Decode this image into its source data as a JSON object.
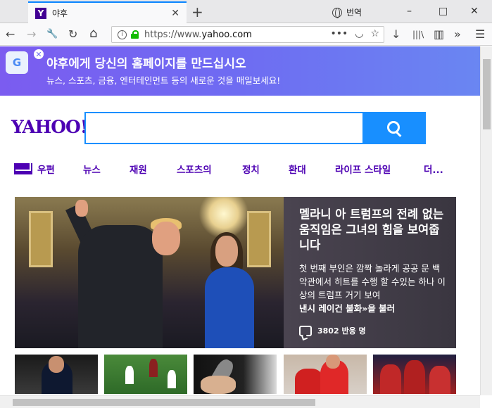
{
  "browser": {
    "tab": {
      "favicon": "Y",
      "title": "야후",
      "close_icon": "close-icon"
    },
    "new_tab_icon": "plus-icon",
    "translate": {
      "label": "번역",
      "icon": "globe-icon"
    },
    "window_controls": {
      "minimize": "–",
      "maximize": "□",
      "close": "✕"
    },
    "toolbar": {
      "back": "←",
      "forward": "→",
      "tools": "🔧",
      "reload": "↻",
      "home": "⌂",
      "url_prefix": "https://www.",
      "url_domain": "yahoo.com",
      "page_actions": "•••",
      "pocket": "◡",
      "bookmark": "☆",
      "download": "↓",
      "library": "|||\\",
      "sidebar": "▥",
      "overflow": "»",
      "menu": "☰"
    }
  },
  "banner": {
    "logo": "G",
    "title": "야후에게 당신의 홈페이지를 만드십시오",
    "subtitle": "뉴스, 스포츠, 금융, 엔터테인먼트 등의 새로운 것을 매일보세요!"
  },
  "header": {
    "logo": "YAHOO!",
    "search_placeholder": ""
  },
  "nav": {
    "items": [
      {
        "label": "우편"
      },
      {
        "label": "뉴스"
      },
      {
        "label": "재원"
      },
      {
        "label": "스포츠의"
      },
      {
        "label": "정치"
      },
      {
        "label": "환대"
      },
      {
        "label": "라이프 스타일"
      },
      {
        "label": "더..."
      }
    ]
  },
  "hero": {
    "title": "멜라니 아 트럼프의 전례 없는 움직임은 그녀의 힘을 보여줍니다",
    "desc": "첫 번째 부인은 깜짝 놀라게 공공 문 백악관에서 히트를 수행 할 수있는 하나 이상의 트럼프 거기 보여",
    "desc_bold": "낸시 레이건 불화»을 불러",
    "comments": "3802 반응 명"
  },
  "colors": {
    "brand": "#4d00b3",
    "search_blue": "#188fff",
    "banner_start": "#7b5cf0",
    "banner_end": "#6a86f2"
  }
}
